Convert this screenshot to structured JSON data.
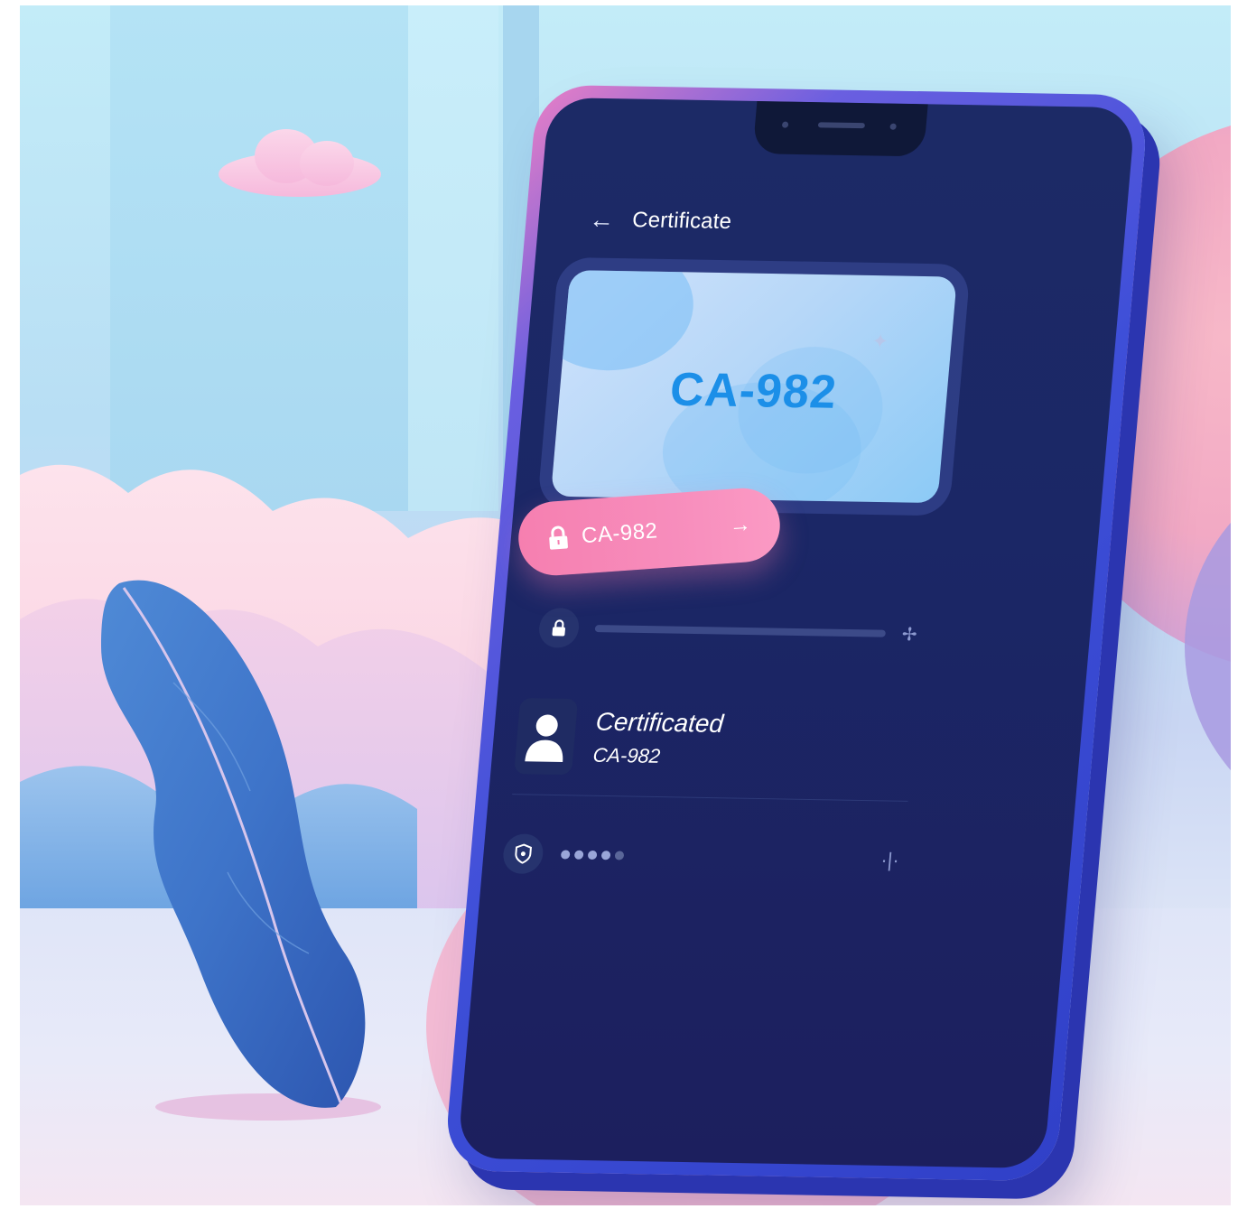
{
  "app": {
    "title": "Certificate",
    "back_icon": "back-arrow-icon"
  },
  "certificate_card": {
    "code": "CA-982"
  },
  "pill": {
    "code": "CA-982",
    "lock_icon": "lock-icon",
    "arrow_icon": "arrow-right-icon"
  },
  "lock_row": {
    "icon": "lock-icon",
    "end_icon": "sparkle-icon"
  },
  "certificate_row": {
    "name": "Certificated",
    "code": "CA-982",
    "avatar_icon": "user-icon"
  },
  "pin_row": {
    "icon": "shield-icon",
    "filled_dots": 4,
    "total_dots": 5,
    "action_icon": "sparkle-icon"
  },
  "colors": {
    "screen_bg": "#1c2a66",
    "phone_frame": "#3e4fd8",
    "pill": "#f67fb0",
    "card": "#b6d7f8",
    "card_code": "#1c8fe8"
  }
}
